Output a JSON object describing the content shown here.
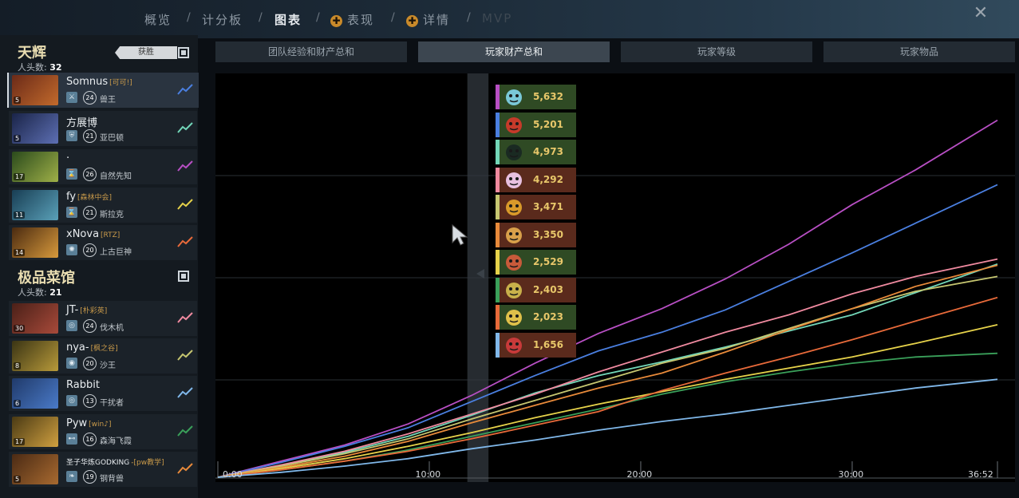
{
  "nav": {
    "overview": "概览",
    "scoreboard": "计分板",
    "graphs": "图表",
    "performance": "表现",
    "details": "详情",
    "mvp": "MVP",
    "separator": "/"
  },
  "teams": {
    "radiant": {
      "name": "天辉",
      "kills_label": "人头数:",
      "kills": "32",
      "victory": "获胜"
    },
    "dire": {
      "name": "极品菜馆",
      "kills_label": "人头数:",
      "kills": "21"
    }
  },
  "players": [
    {
      "name": "Somnus",
      "tag": "[可可!]",
      "level": "24",
      "hero": "兽王",
      "portrait_level": "5",
      "line_color": "#4a7fe0",
      "portrait_colors": [
        "#6b2a18",
        "#c26a2c"
      ],
      "role_icon": "sword-icon",
      "role_glyph": "⚔"
    },
    {
      "name": "方展博",
      "tag": "",
      "level": "21",
      "hero": "亚巴顿",
      "portrait_level": "5",
      "line_color": "#72d6b8",
      "portrait_colors": [
        "#1a2448",
        "#5d6fb3"
      ],
      "role_icon": "shield-icon",
      "role_glyph": "⛨"
    },
    {
      "name": "·",
      "tag": "",
      "level": "26",
      "hero": "自然先知",
      "portrait_level": "17",
      "line_color": "#b84fc4",
      "portrait_colors": [
        "#2a4a1c",
        "#9fb048"
      ],
      "role_icon": "hourglass-icon",
      "role_glyph": "⌛"
    },
    {
      "name": "fy",
      "tag": "[森林中会]",
      "level": "21",
      "hero": "斯拉克",
      "portrait_level": "11",
      "line_color": "#e6d24a",
      "portrait_colors": [
        "#183e54",
        "#5aa0b8"
      ],
      "role_icon": "hourglass-icon",
      "role_glyph": "⌛"
    },
    {
      "name": "xNova",
      "tag": "[RTZ]",
      "level": "20",
      "hero": "上古巨神",
      "portrait_level": "14",
      "line_color": "#e86a3a",
      "portrait_colors": [
        "#4a2a10",
        "#d89a3c"
      ],
      "role_icon": "spiral-icon",
      "role_glyph": "✺"
    },
    {
      "name": "JT-",
      "tag": "[朴彩英]",
      "level": "24",
      "hero": "伐木机",
      "portrait_level": "30",
      "line_color": "#f08aa0",
      "portrait_colors": [
        "#4a2018",
        "#a84a3a"
      ],
      "role_icon": "target-icon",
      "role_glyph": "◎"
    },
    {
      "name": "nya-",
      "tag": "[枫之谷]",
      "level": "20",
      "hero": "沙王",
      "portrait_level": "8",
      "line_color": "#c6c670",
      "portrait_colors": [
        "#3a3414",
        "#b89a3a"
      ],
      "role_icon": "eye-icon",
      "role_glyph": "◉"
    },
    {
      "name": "Rabbit",
      "tag": "",
      "level": "13",
      "hero": "干扰者",
      "portrait_level": "6",
      "line_color": "#80b8ea",
      "portrait_colors": [
        "#203a6a",
        "#4a7ac8"
      ],
      "role_icon": "target-icon",
      "role_glyph": "◎"
    },
    {
      "name": "Pyw",
      "tag": "[win♪]",
      "level": "16",
      "hero": "森海飞霞",
      "portrait_level": "17",
      "line_color": "#3aa05a",
      "portrait_colors": [
        "#4a3a14",
        "#d0a040"
      ],
      "role_icon": "bone-icon",
      "role_glyph": "⊷"
    },
    {
      "name": "圣子华炼GODKING",
      "tag": "-[pw教学]",
      "level": "19",
      "hero": "钢背兽",
      "portrait_level": "5",
      "line_color": "#e88a3a",
      "portrait_colors": [
        "#4a2a14",
        "#a86a30"
      ],
      "role_icon": "leaf-icon",
      "role_glyph": "❧"
    }
  ],
  "graph_tabs": [
    "团队经验和财产总和",
    "玩家财产总和",
    "玩家等级",
    "玩家物品"
  ],
  "legend": [
    {
      "value": "5,632",
      "color": "#b84fc4",
      "bg": "#2f4a24",
      "face": "#7ac8d8"
    },
    {
      "value": "5,201",
      "color": "#4a7fe0",
      "bg": "#2f4a24",
      "face": "#c63a2a"
    },
    {
      "value": "4,973",
      "color": "#72d6b8",
      "bg": "#2f4a24",
      "face": "#1a2a22"
    },
    {
      "value": "4,292",
      "color": "#f08aa0",
      "bg": "#5a2a1c",
      "face": "#e8c0e0"
    },
    {
      "value": "3,471",
      "color": "#c6c670",
      "bg": "#5a2a1c",
      "face": "#d89a2a"
    },
    {
      "value": "3,350",
      "color": "#e88a3a",
      "bg": "#5a2a1c",
      "face": "#d8a04a"
    },
    {
      "value": "2,529",
      "color": "#e6d24a",
      "bg": "#2f4a24",
      "face": "#c85a3a"
    },
    {
      "value": "2,403",
      "color": "#3aa05a",
      "bg": "#5a2a1c",
      "face": "#c8b04a"
    },
    {
      "value": "2,023",
      "color": "#e86a3a",
      "bg": "#2f4a24",
      "face": "#e0c04a"
    },
    {
      "value": "1,656",
      "color": "#80b8ea",
      "bg": "#5a2a1c",
      "face": "#c83a3a"
    }
  ],
  "chart_data": {
    "type": "line",
    "x_ticks": [
      "0:00",
      "10:00",
      "20:00",
      "30:00",
      "36:52"
    ],
    "x_tick_minutes": [
      0,
      10,
      20,
      30,
      36.87
    ],
    "x_range": [
      0,
      36.87
    ],
    "y_range": [
      0,
      30000
    ],
    "grid": true,
    "highlight_band_minutes": [
      11.8,
      12.8
    ],
    "x": [
      0,
      3,
      6,
      9,
      12,
      15,
      18,
      21,
      24,
      27,
      30,
      33,
      36.87
    ],
    "series": [
      {
        "color": "#b84fc4",
        "values": [
          0,
          1300,
          2600,
          4300,
          6600,
          9200,
          11600,
          13600,
          16000,
          18800,
          22000,
          24800,
          28800
        ]
      },
      {
        "color": "#4a7fe0",
        "values": [
          0,
          1200,
          2500,
          4000,
          6100,
          8200,
          10200,
          11700,
          13500,
          15800,
          18100,
          20500,
          23600
        ]
      },
      {
        "color": "#72d6b8",
        "values": [
          0,
          900,
          2000,
          3300,
          5000,
          6800,
          8200,
          9300,
          10500,
          11800,
          13100,
          14900,
          17200
        ]
      },
      {
        "color": "#f08aa0",
        "values": [
          0,
          1000,
          2100,
          3500,
          5100,
          6700,
          8500,
          10100,
          11700,
          13100,
          14800,
          16200,
          17600
        ]
      },
      {
        "color": "#c6c670",
        "values": [
          0,
          900,
          1900,
          3100,
          4700,
          6200,
          7700,
          9200,
          10400,
          12000,
          13600,
          15000,
          16200
        ]
      },
      {
        "color": "#e88a3a",
        "values": [
          0,
          800,
          1700,
          2900,
          4400,
          5800,
          7200,
          8400,
          10100,
          11900,
          13600,
          15400,
          17100
        ]
      },
      {
        "color": "#e6d24a",
        "values": [
          0,
          700,
          1500,
          2500,
          3600,
          4800,
          5900,
          6900,
          7900,
          8800,
          9700,
          10800,
          12300
        ]
      },
      {
        "color": "#3aa05a",
        "values": [
          0,
          600,
          1300,
          2200,
          3300,
          4400,
          5500,
          6700,
          7700,
          8500,
          9200,
          9700,
          10000
        ]
      },
      {
        "color": "#e86a3a",
        "values": [
          0,
          600,
          1300,
          2100,
          3100,
          4200,
          5300,
          7000,
          8400,
          9700,
          11100,
          12600,
          14500
        ]
      },
      {
        "color": "#80b8ea",
        "values": [
          0,
          400,
          900,
          1500,
          2300,
          3000,
          3800,
          4500,
          5100,
          5800,
          6500,
          7200,
          7900
        ]
      }
    ]
  }
}
